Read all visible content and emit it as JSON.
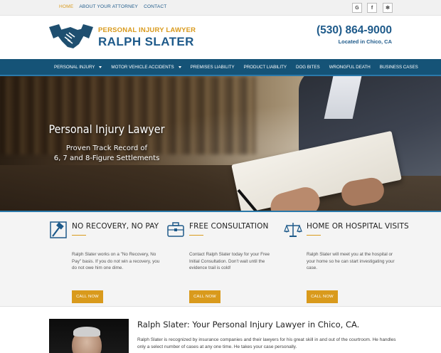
{
  "topnav": {
    "items": [
      {
        "label": "HOME",
        "active": true
      },
      {
        "label": "ABOUT YOUR ATTORNEY",
        "active": false
      },
      {
        "label": "CONTACT",
        "active": false
      }
    ]
  },
  "social": {
    "icons": [
      "google-icon",
      "facebook-icon",
      "yelp-icon"
    ],
    "glyphs": [
      "G",
      "f",
      "✻"
    ]
  },
  "header": {
    "tagline": "PERSONAL INJURY LAWYER",
    "name": "RALPH SLATER",
    "phone": "(530) 864-9000",
    "location": "Located in Chico, CA",
    "logo_icon": "handshake-icon"
  },
  "mainnav": {
    "items": [
      {
        "label": "PERSONAL INJURY",
        "dropdown": true
      },
      {
        "label": "MOTOR VEHICLE ACCIDENTS",
        "dropdown": true
      },
      {
        "label": "PREMISES LIABILITY",
        "dropdown": false
      },
      {
        "label": "PRODUCT LIABILITY",
        "dropdown": false
      },
      {
        "label": "DOG BITES",
        "dropdown": false
      },
      {
        "label": "WRONGFUL DEATH",
        "dropdown": false
      },
      {
        "label": "BUSINESS CASES",
        "dropdown": false
      }
    ]
  },
  "hero": {
    "title": "Personal Injury Lawyer",
    "line1": "Proven Track Record of",
    "line2": "6, 7 and 8-Figure Settlements"
  },
  "features": [
    {
      "icon": "gavel-icon",
      "title": "NO RECOVERY, NO PAY",
      "text": "Ralph Slater works on a \"No Recovery, No Pay\" basis. If you do not win a recovery, you do not owe him one dime.",
      "button": "CALL NOW"
    },
    {
      "icon": "briefcase-icon",
      "title": "FREE CONSULTATION",
      "text": "Contact Ralph Slater today for your Free Initial Consultation. Don't wait until the evidence trail is cold!",
      "button": "CALL NOW"
    },
    {
      "icon": "scales-icon",
      "title": "HOME OR HOSPITAL VISITS",
      "text": "Ralph Slater will meet you at the hospital or your home so he can start investigating your case.",
      "button": "CALL NOW"
    }
  ],
  "about": {
    "title": "Ralph Slater: Your Personal Injury Lawyer in Chico, CA.",
    "text": "Ralph Slater is recognized by insurance companies and their lawyers for his great skill in and out of the courtroom. He handles only a select number of cases at any one time. He takes your case personally."
  },
  "colors": {
    "brand_blue": "#1e5a8a",
    "nav_blue": "#155377",
    "accent_gold": "#d99a1c"
  }
}
